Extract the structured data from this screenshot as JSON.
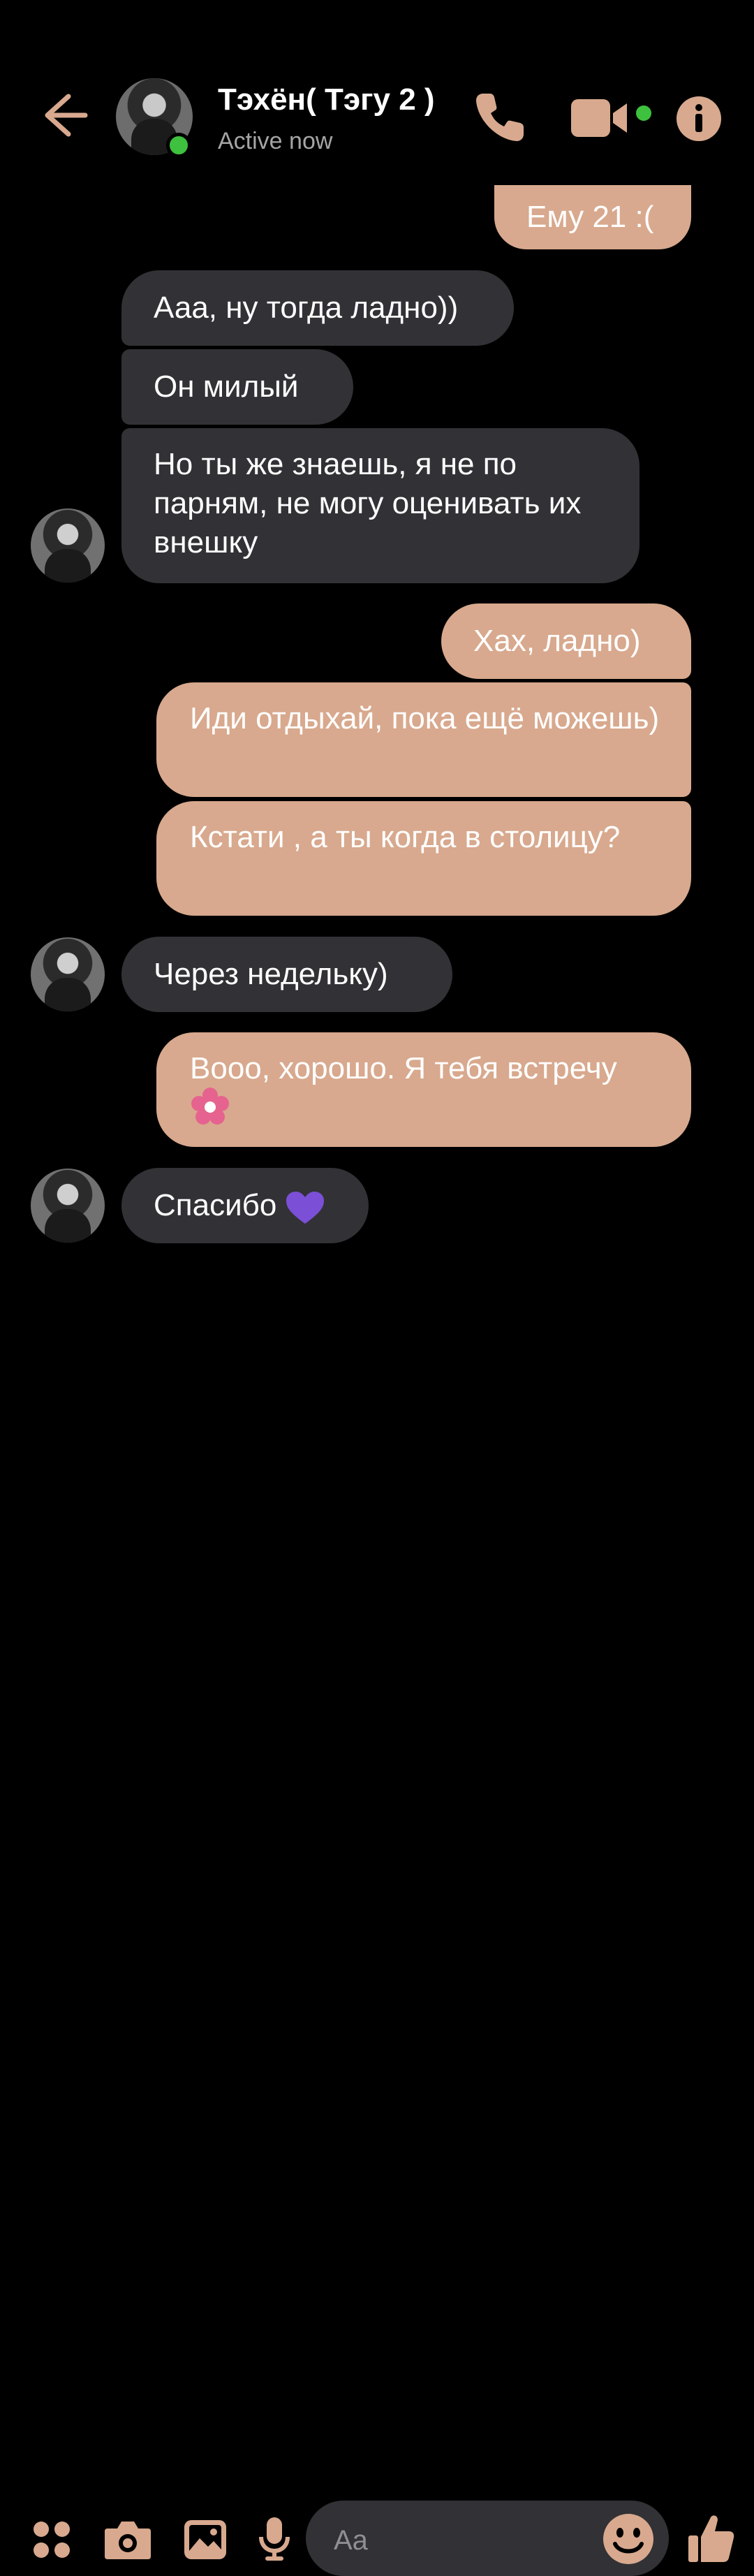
{
  "header": {
    "contact_name": "Тэхён( Тэгу 2 )",
    "status": "Active now",
    "back_icon": "back-arrow-icon",
    "call_icon": "phone-icon",
    "video_icon": "video-camera-icon",
    "info_icon": "info-icon"
  },
  "messages": [
    {
      "direction": "out",
      "text": "Ему 21 :("
    },
    {
      "direction": "in",
      "text": "Ааа, ну тогда ладно))"
    },
    {
      "direction": "in",
      "text": "Он милый"
    },
    {
      "direction": "in",
      "text": "Но ты же знаешь, я не по парням, не могу оценивать их внешку"
    },
    {
      "direction": "out",
      "text": "Хах, ладно)"
    },
    {
      "direction": "out",
      "text": "Иди отдыхай, пока ещё можешь)"
    },
    {
      "direction": "out",
      "text": "Кстати , а ты когда в столицу?"
    },
    {
      "direction": "in",
      "text": "Через недельку)"
    },
    {
      "direction": "out",
      "text": "Вооо, хорошо. Я тебя встречу",
      "emoji": "flower-icon"
    },
    {
      "direction": "in",
      "text": "Спасибо",
      "emoji": "purple-heart-icon"
    }
  ],
  "composer": {
    "placeholder": "Aa",
    "apps_icon": "apps-grid-icon",
    "camera_icon": "camera-icon",
    "gallery_icon": "image-icon",
    "mic_icon": "microphone-icon",
    "emoji_icon": "smiley-icon",
    "like_icon": "thumbs-up-icon"
  },
  "colors": {
    "accent": "#d8a98e",
    "incoming_bubble": "#323135",
    "background": "#000000",
    "online": "#3ec13e"
  }
}
